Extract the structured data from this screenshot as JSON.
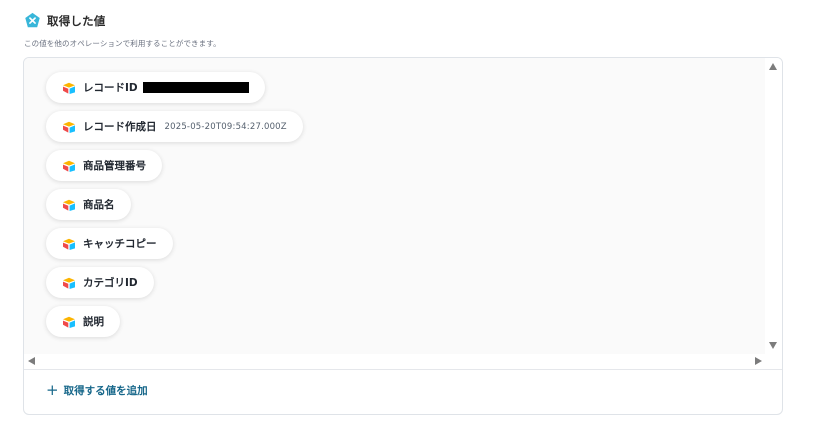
{
  "header": {
    "icon": "yoom-x-icon",
    "title": "取得した値",
    "subtitle": "この値を他のオペレーションで利用することができます。"
  },
  "colors": {
    "accent": "#17678a",
    "header_icon": "#38b6d9",
    "airtable_red": "#f04a4a",
    "airtable_yellow": "#fcb400",
    "airtable_blue": "#18bfff"
  },
  "fields": [
    {
      "label": "レコードID",
      "value": "",
      "redacted": true,
      "icon": "airtable-icon"
    },
    {
      "label": "レコード作成日",
      "value": "2025-05-20T09:54:27.000Z",
      "icon": "airtable-icon"
    },
    {
      "label": "商品管理番号",
      "value": "",
      "icon": "airtable-icon"
    },
    {
      "label": "商品名",
      "value": "",
      "icon": "airtable-icon"
    },
    {
      "label": "キャッチコピー",
      "value": "",
      "icon": "airtable-icon"
    },
    {
      "label": "カテゴリID",
      "value": "",
      "icon": "airtable-icon"
    },
    {
      "label": "説明",
      "value": "",
      "icon": "airtable-icon"
    }
  ],
  "add_button": {
    "icon": "plus-icon",
    "symbol": "+",
    "label": "取得する値を追加"
  }
}
